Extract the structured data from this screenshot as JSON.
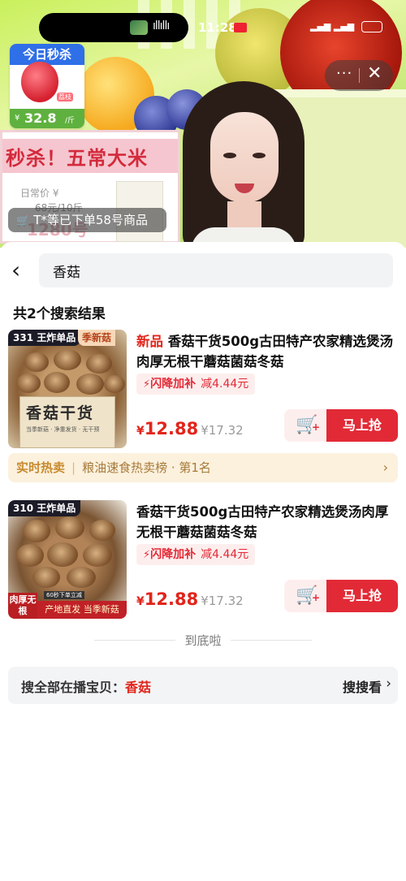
{
  "status_bar": {
    "time": "11:28"
  },
  "live": {
    "flash_sale": {
      "title": "今日秒杀",
      "product_tag": "荔枝",
      "currency": "¥",
      "price": "32.8",
      "unit": "/斤"
    },
    "sign": {
      "title": "秒杀！五常大米",
      "price_label": "日常价 ¥",
      "old_price": "68元/10斤",
      "big_text": "1280号"
    },
    "order_toast": "T*等已下单58号商品"
  },
  "search": {
    "query": "香菇"
  },
  "results_summary": "共2个搜索结果",
  "products": [
    {
      "rank_tag": "331 王炸单品",
      "season_tag": "季新菇",
      "crate_title": "香菇干货",
      "crate_sub": "当季新菇 · 净重发货 · 无干预",
      "new_label": "新品",
      "title": "香菇干货500g古田特产农家精选煲汤肉厚无根干蘑菇菌菇冬菇",
      "promo_name": "闪降加补",
      "promo_amount": "减4.44元",
      "currency": "¥",
      "price": "12.88",
      "old_price": "¥17.32",
      "buy_label": "马上抢"
    },
    {
      "rank_tag": "310 王炸单品",
      "badge_left": "肉厚无根",
      "strip_top": "60秒下单立减",
      "strip": "产地直发 当季新菇",
      "title": "香菇干货500g古田特产农家精选煲汤肉厚无根干蘑菇菌菇冬菇",
      "promo_name": "闪降加补",
      "promo_amount": "减4.44元",
      "currency": "¥",
      "price": "12.88",
      "old_price": "¥17.32",
      "buy_label": "马上抢"
    }
  ],
  "hot_bar": {
    "label": "实时热卖",
    "text": "粮油速食热卖榜 · 第1名"
  },
  "end_text": "到底啦",
  "all_bar": {
    "label": "搜全部在播宝贝：",
    "keyword": "香菇",
    "action": "搜搜看"
  },
  "colors": {
    "accent": "#e22a36",
    "price": "#e1251b",
    "hot_bg": "#fcf1dd"
  }
}
